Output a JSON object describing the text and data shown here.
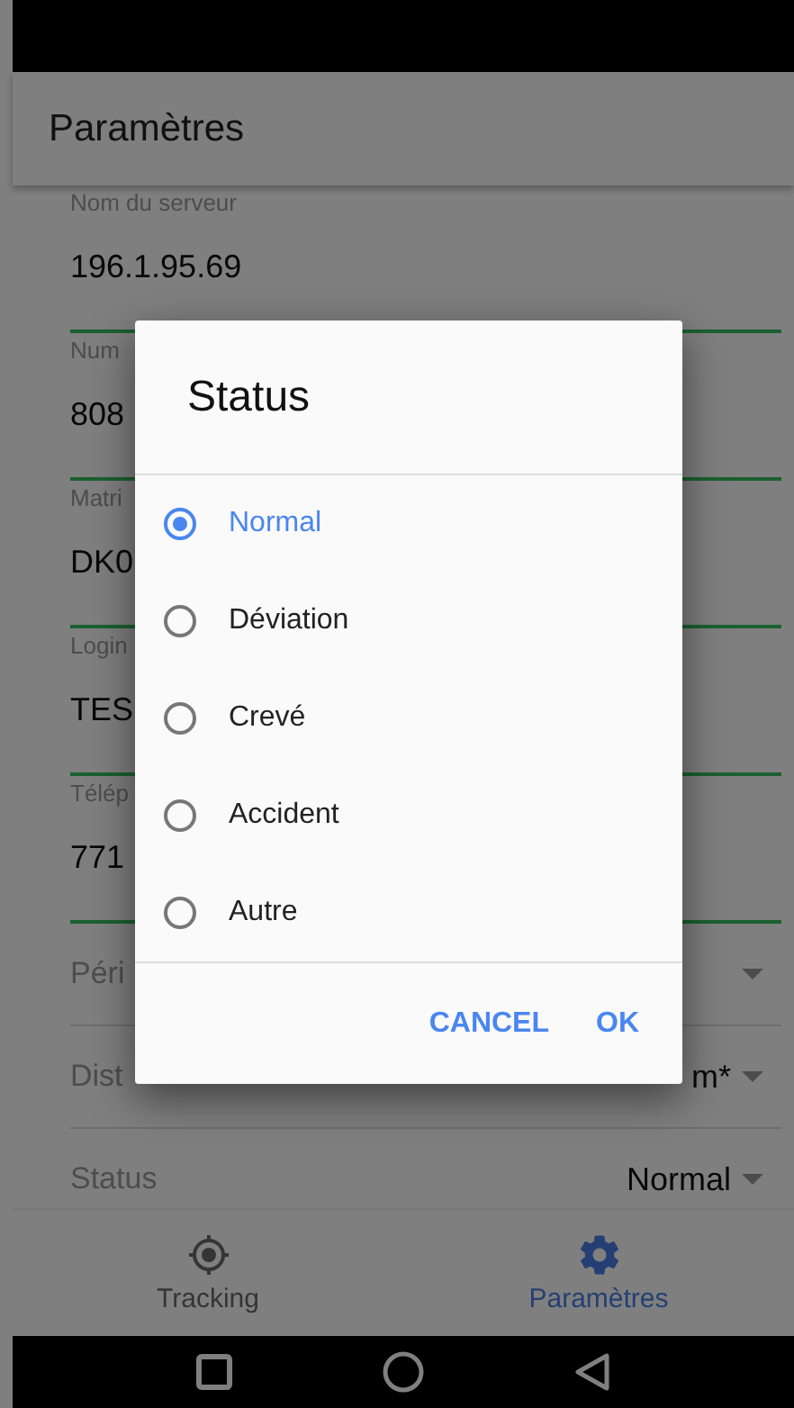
{
  "app_bar": {
    "title": "Paramètres"
  },
  "fields": [
    {
      "kind": "text",
      "label": "Nom du serveur",
      "value": "196.1.95.69"
    },
    {
      "kind": "text",
      "label": "Num",
      "value": "808"
    },
    {
      "kind": "text",
      "label": "Matri",
      "value": "DK0"
    },
    {
      "kind": "text",
      "label": "Login",
      "value": "TES"
    },
    {
      "kind": "text",
      "label": "Télép",
      "value": "771"
    },
    {
      "kind": "select",
      "label": "Péri"
    },
    {
      "kind": "select",
      "label": "Dist",
      "value": "m*"
    },
    {
      "kind": "select",
      "label": "Status",
      "value": "Normal"
    }
  ],
  "dialog": {
    "title": "Status",
    "options": [
      {
        "label": "Normal",
        "selected": true
      },
      {
        "label": "Déviation",
        "selected": false
      },
      {
        "label": "Crevé",
        "selected": false
      },
      {
        "label": "Accident",
        "selected": false
      },
      {
        "label": "Autre",
        "selected": false
      }
    ],
    "buttons": [
      "CANCEL",
      "OK"
    ]
  },
  "bottom_nav": [
    {
      "label": "Tracking",
      "kind": "target",
      "selected": false
    },
    {
      "label": "Paramètres",
      "kind": "gear",
      "selected": true
    }
  ]
}
